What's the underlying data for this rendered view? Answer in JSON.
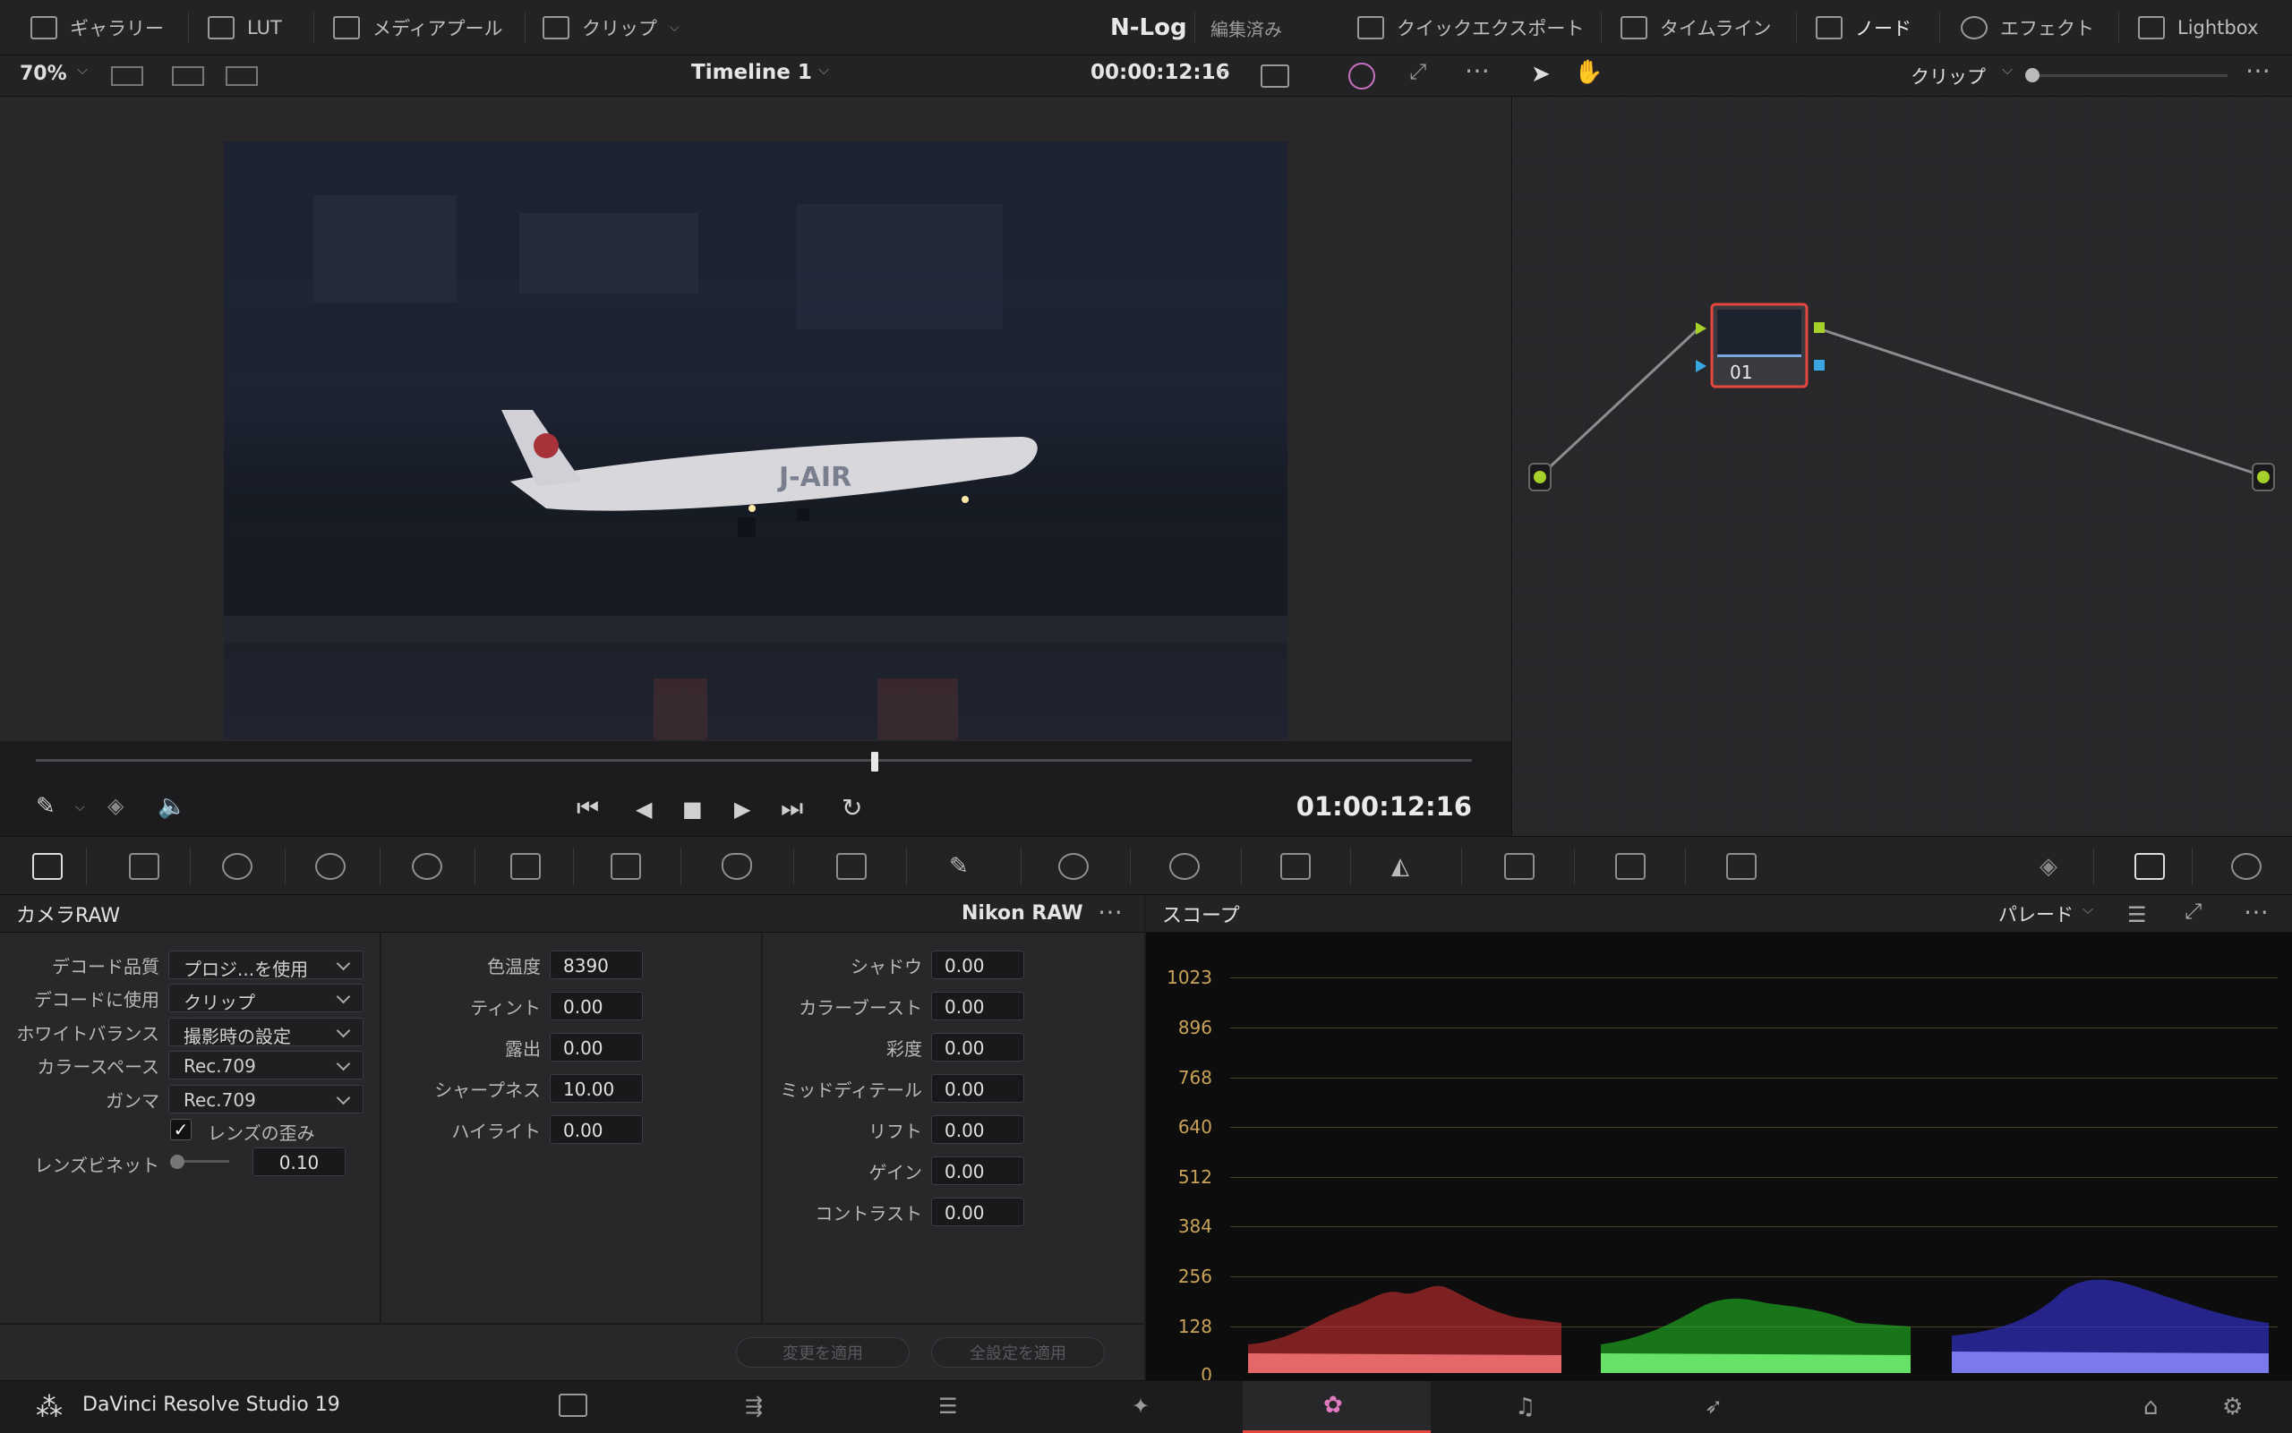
{
  "topbar": {
    "gallery": "ギャラリー",
    "lut": "LUT",
    "media_pool": "メディアプール",
    "clip": "クリップ",
    "project_name": "N-Log",
    "project_status": "編集済み",
    "quick_export": "クイックエクスポート",
    "timeline": "タイムライン",
    "nodes": "ノード",
    "effects": "エフェクト",
    "lightbox": "Lightbox"
  },
  "viewer": {
    "zoom": "70%",
    "timeline_name": "Timeline 1",
    "source_timecode": "00:00:12:16",
    "record_timecode": "01:00:12:16",
    "playhead_fraction": 0.584
  },
  "node_editor": {
    "mode": "クリップ",
    "node_label": "01"
  },
  "camera_raw": {
    "title": "カメラRAW",
    "format": "Nikon RAW",
    "col1": [
      {
        "label": "デコード品質",
        "value": "プロジ...を使用"
      },
      {
        "label": "デコードに使用",
        "value": "クリップ"
      },
      {
        "label": "ホワイトバランス",
        "value": "撮影時の設定"
      },
      {
        "label": "カラースペース",
        "value": "Rec.709"
      },
      {
        "label": "ガンマ",
        "value": "Rec.709"
      }
    ],
    "lens_distortion": "レンズの歪み",
    "lens_vignette": {
      "label": "レンズビネット",
      "value": "0.10"
    },
    "col2": [
      {
        "label": "色温度",
        "value": "8390"
      },
      {
        "label": "ティント",
        "value": "0.00"
      },
      {
        "label": "露出",
        "value": "0.00"
      },
      {
        "label": "シャープネス",
        "value": "10.00"
      },
      {
        "label": "ハイライト",
        "value": "0.00"
      }
    ],
    "col3": [
      {
        "label": "シャドウ",
        "value": "0.00"
      },
      {
        "label": "カラーブースト",
        "value": "0.00"
      },
      {
        "label": "彩度",
        "value": "0.00"
      },
      {
        "label": "ミッドディテール",
        "value": "0.00"
      },
      {
        "label": "リフト",
        "value": "0.00"
      },
      {
        "label": "ゲイン",
        "value": "0.00"
      },
      {
        "label": "コントラスト",
        "value": "0.00"
      }
    ],
    "apply_changes": "変更を適用",
    "apply_all": "全設定を適用"
  },
  "scope": {
    "title": "スコープ",
    "mode": "パレード",
    "y_ticks": [
      "1023",
      "896",
      "768",
      "640",
      "512",
      "384",
      "256",
      "128",
      "0"
    ]
  },
  "bottombar": {
    "app_name": "DaVinci Resolve Studio 19"
  },
  "colors": {
    "accent": "#e5473f",
    "tick_label": "#c9a25a",
    "node_input": "#a6d02a"
  }
}
